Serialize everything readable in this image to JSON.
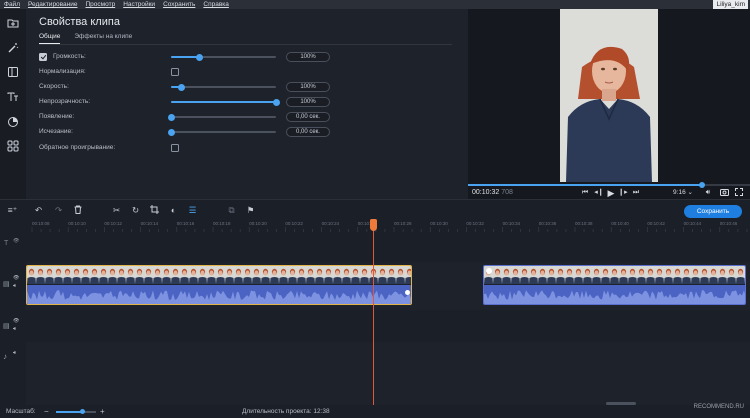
{
  "menubar": {
    "items": [
      "Файл",
      "Редактирование",
      "Просмотр",
      "Настройки",
      "Сохранить",
      "Справка"
    ],
    "user": "Liliya_kim"
  },
  "left_tools": [
    "import-icon",
    "magic-wand-icon",
    "crop-frame-icon",
    "text-icon",
    "sticker-icon",
    "grid-icon"
  ],
  "properties": {
    "title": "Свойства клипа",
    "tabs": [
      "Общие",
      "Эффекты на клипе"
    ],
    "active_tab": 0,
    "rows": {
      "volume": {
        "label": "Громкость:",
        "checked": true,
        "value": "100%",
        "level": 0.27
      },
      "normalize": {
        "label": "Нормализация:",
        "checked": false
      },
      "speed": {
        "label": "Скорость:",
        "value": "100%",
        "level": 0.1
      },
      "opacity": {
        "label": "Непрозрачность:",
        "value": "100%",
        "level": 1.0
      },
      "fade_in": {
        "label": "Появление:",
        "value": "0,00 сек.",
        "level": 0.0
      },
      "fade_out": {
        "label": "Исчезание:",
        "value": "0,00 сек.",
        "level": 0.0
      },
      "reverse": {
        "label": "Обратное проигрывание:",
        "checked": false
      }
    }
  },
  "preview": {
    "timecode": "00:10:32",
    "timecode_ms": "708",
    "aspect": "9:16",
    "progress": 0.83
  },
  "toolbar": {
    "save_label": "Сохранить",
    "icons": [
      "undo-icon",
      "redo-icon",
      "delete-icon",
      "cut-icon",
      "rotate-icon",
      "crop-icon",
      "color-adjust-icon",
      "clip-properties-icon",
      "overlay-icon",
      "flag-icon"
    ]
  },
  "ruler": {
    "ticks": [
      "00:10:08",
      "00:10:10",
      "00:10:12",
      "00:10:14",
      "00:10:16",
      "00:10:18",
      "00:10:20",
      "00:10:22",
      "00:10:24",
      "00:10:26",
      "00:10:28",
      "00:10:30",
      "00:10:32",
      "00:10:34",
      "00:10:36",
      "00:10:38",
      "00:10:40",
      "00:10:42",
      "00:10:44",
      "00:10:46"
    ]
  },
  "bottom": {
    "scale_label": "Масштаб:",
    "zoom": 0.65,
    "duration_label": "Длительность проекта:",
    "duration": "12:38"
  },
  "watermark": "RECOMMEND.RU",
  "colors": {
    "accent": "#1e7fe0",
    "slider": "#4aa3f0",
    "playhead": "#e2573c",
    "audio": "#4b63c2",
    "selected_clip": "#e3b44a"
  }
}
